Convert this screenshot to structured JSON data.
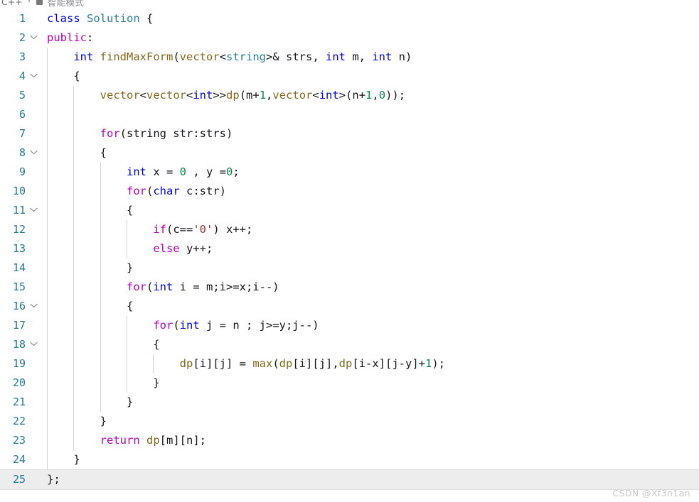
{
  "toolbar": {
    "language": "C++",
    "caret_icon": "chevron-down-icon",
    "stop_icon": "square-icon",
    "mode_label": "智能模式"
  },
  "editor": {
    "language": "cpp",
    "current_line": 25,
    "gutter": {
      "fold_lines": [
        2,
        4,
        8,
        11,
        16,
        18
      ],
      "fold_icon": "chevron-down-icon"
    },
    "colors": {
      "background": "#ffffff",
      "line_number": "#237a91",
      "keyword_type": "#0000ef",
      "keyword_control": "#bb00bb",
      "user_type": "#2b7f8f",
      "identifier": "#7f6a1f",
      "number": "#0b8a52",
      "string": "#9b3030",
      "plain": "#15161a",
      "indent_guide": "#d2d2d2",
      "current_line_highlight": "#ededed"
    },
    "lines": [
      {
        "n": 1,
        "fold": false,
        "guides": [],
        "tokens": [
          {
            "t": "class",
            "c": "k"
          },
          {
            "t": " ",
            "c": "pn"
          },
          {
            "t": "Solution",
            "c": "ty"
          },
          {
            "t": " {",
            "c": "pn"
          }
        ]
      },
      {
        "n": 2,
        "fold": true,
        "guides": [],
        "tokens": [
          {
            "t": "public",
            "c": "kc"
          },
          {
            "t": ":",
            "c": "pn"
          }
        ]
      },
      {
        "n": 3,
        "fold": false,
        "guides": [
          0
        ],
        "tokens": [
          {
            "t": "    ",
            "c": "pn"
          },
          {
            "t": "int",
            "c": "k"
          },
          {
            "t": " ",
            "c": "pn"
          },
          {
            "t": "findMaxForm",
            "c": "fn"
          },
          {
            "t": "(",
            "c": "pn"
          },
          {
            "t": "vector",
            "c": "fn"
          },
          {
            "t": "<",
            "c": "pn"
          },
          {
            "t": "string",
            "c": "ty"
          },
          {
            "t": ">& strs, ",
            "c": "pn"
          },
          {
            "t": "int",
            "c": "k"
          },
          {
            "t": " m, ",
            "c": "pn"
          },
          {
            "t": "int",
            "c": "k"
          },
          {
            "t": " n)",
            "c": "pn"
          }
        ]
      },
      {
        "n": 4,
        "fold": true,
        "guides": [
          0
        ],
        "tokens": [
          {
            "t": "    {",
            "c": "pn"
          }
        ]
      },
      {
        "n": 5,
        "fold": false,
        "guides": [
          0,
          1
        ],
        "tokens": [
          {
            "t": "        ",
            "c": "pn"
          },
          {
            "t": "vector",
            "c": "fn"
          },
          {
            "t": "<",
            "c": "pn"
          },
          {
            "t": "vector",
            "c": "fn"
          },
          {
            "t": "<",
            "c": "pn"
          },
          {
            "t": "int",
            "c": "k"
          },
          {
            "t": ">>",
            "c": "pn"
          },
          {
            "t": "dp",
            "c": "fn"
          },
          {
            "t": "(m+",
            "c": "pn"
          },
          {
            "t": "1",
            "c": "num"
          },
          {
            "t": ",",
            "c": "pn"
          },
          {
            "t": "vector",
            "c": "fn"
          },
          {
            "t": "<",
            "c": "pn"
          },
          {
            "t": "int",
            "c": "k"
          },
          {
            "t": ">(n+",
            "c": "pn"
          },
          {
            "t": "1",
            "c": "num"
          },
          {
            "t": ",",
            "c": "pn"
          },
          {
            "t": "0",
            "c": "num"
          },
          {
            "t": "));",
            "c": "pn"
          }
        ]
      },
      {
        "n": 6,
        "fold": false,
        "guides": [
          0,
          1
        ],
        "tokens": []
      },
      {
        "n": 7,
        "fold": false,
        "guides": [
          0,
          1
        ],
        "tokens": [
          {
            "t": "        ",
            "c": "pn"
          },
          {
            "t": "for",
            "c": "kc"
          },
          {
            "t": "(string str:strs)",
            "c": "pn"
          }
        ]
      },
      {
        "n": 8,
        "fold": true,
        "guides": [
          0,
          1
        ],
        "tokens": [
          {
            "t": "        {",
            "c": "pn"
          }
        ]
      },
      {
        "n": 9,
        "fold": false,
        "guides": [
          0,
          1,
          2
        ],
        "tokens": [
          {
            "t": "            ",
            "c": "pn"
          },
          {
            "t": "int",
            "c": "k"
          },
          {
            "t": " x = ",
            "c": "pn"
          },
          {
            "t": "0",
            "c": "num"
          },
          {
            "t": " , y =",
            "c": "pn"
          },
          {
            "t": "0",
            "c": "num"
          },
          {
            "t": ";",
            "c": "pn"
          }
        ]
      },
      {
        "n": 10,
        "fold": false,
        "guides": [
          0,
          1,
          2
        ],
        "tokens": [
          {
            "t": "            ",
            "c": "pn"
          },
          {
            "t": "for",
            "c": "kc"
          },
          {
            "t": "(",
            "c": "pn"
          },
          {
            "t": "char",
            "c": "k"
          },
          {
            "t": " c:str)",
            "c": "pn"
          }
        ]
      },
      {
        "n": 11,
        "fold": true,
        "guides": [
          0,
          1,
          2
        ],
        "tokens": [
          {
            "t": "            {",
            "c": "pn"
          }
        ]
      },
      {
        "n": 12,
        "fold": false,
        "guides": [
          0,
          1,
          2,
          3
        ],
        "tokens": [
          {
            "t": "                ",
            "c": "pn"
          },
          {
            "t": "if",
            "c": "kc"
          },
          {
            "t": "(c==",
            "c": "pn"
          },
          {
            "t": "'0'",
            "c": "str"
          },
          {
            "t": ") x++;",
            "c": "pn"
          }
        ]
      },
      {
        "n": 13,
        "fold": false,
        "guides": [
          0,
          1,
          2,
          3
        ],
        "tokens": [
          {
            "t": "                ",
            "c": "pn"
          },
          {
            "t": "else",
            "c": "kc"
          },
          {
            "t": " y++;",
            "c": "pn"
          }
        ]
      },
      {
        "n": 14,
        "fold": false,
        "guides": [
          0,
          1,
          2
        ],
        "tokens": [
          {
            "t": "            }",
            "c": "pn"
          }
        ]
      },
      {
        "n": 15,
        "fold": false,
        "guides": [
          0,
          1,
          2
        ],
        "tokens": [
          {
            "t": "            ",
            "c": "pn"
          },
          {
            "t": "for",
            "c": "kc"
          },
          {
            "t": "(",
            "c": "pn"
          },
          {
            "t": "int",
            "c": "k"
          },
          {
            "t": " i = m;i>=x;i--)",
            "c": "pn"
          }
        ]
      },
      {
        "n": 16,
        "fold": true,
        "guides": [
          0,
          1,
          2
        ],
        "tokens": [
          {
            "t": "            {",
            "c": "pn"
          }
        ]
      },
      {
        "n": 17,
        "fold": false,
        "guides": [
          0,
          1,
          2,
          3
        ],
        "tokens": [
          {
            "t": "                ",
            "c": "pn"
          },
          {
            "t": "for",
            "c": "kc"
          },
          {
            "t": "(",
            "c": "pn"
          },
          {
            "t": "int",
            "c": "k"
          },
          {
            "t": " j = n ; j>=y;j--)",
            "c": "pn"
          }
        ]
      },
      {
        "n": 18,
        "fold": true,
        "guides": [
          0,
          1,
          2,
          3
        ],
        "tokens": [
          {
            "t": "                {",
            "c": "pn"
          }
        ]
      },
      {
        "n": 19,
        "fold": false,
        "guides": [
          0,
          1,
          2,
          3,
          4
        ],
        "tokens": [
          {
            "t": "                    ",
            "c": "pn"
          },
          {
            "t": "dp",
            "c": "fn"
          },
          {
            "t": "[i][j] = ",
            "c": "pn"
          },
          {
            "t": "max",
            "c": "fn"
          },
          {
            "t": "(",
            "c": "pn"
          },
          {
            "t": "dp",
            "c": "fn"
          },
          {
            "t": "[i][j],",
            "c": "pn"
          },
          {
            "t": "dp",
            "c": "fn"
          },
          {
            "t": "[i-x][j-y]+",
            "c": "pn"
          },
          {
            "t": "1",
            "c": "num"
          },
          {
            "t": ");",
            "c": "pn"
          }
        ]
      },
      {
        "n": 20,
        "fold": false,
        "guides": [
          0,
          1,
          2,
          3
        ],
        "tokens": [
          {
            "t": "                }",
            "c": "pn"
          }
        ]
      },
      {
        "n": 21,
        "fold": false,
        "guides": [
          0,
          1,
          2
        ],
        "tokens": [
          {
            "t": "            }",
            "c": "pn"
          }
        ]
      },
      {
        "n": 22,
        "fold": false,
        "guides": [
          0,
          1
        ],
        "tokens": [
          {
            "t": "        }",
            "c": "pn"
          }
        ]
      },
      {
        "n": 23,
        "fold": false,
        "guides": [
          0,
          1
        ],
        "tokens": [
          {
            "t": "        ",
            "c": "pn"
          },
          {
            "t": "return",
            "c": "kc"
          },
          {
            "t": " ",
            "c": "pn"
          },
          {
            "t": "dp",
            "c": "fn"
          },
          {
            "t": "[m][n];",
            "c": "pn"
          }
        ]
      },
      {
        "n": 24,
        "fold": false,
        "guides": [
          0
        ],
        "tokens": [
          {
            "t": "    }",
            "c": "pn"
          }
        ]
      },
      {
        "n": 25,
        "fold": false,
        "guides": [],
        "tokens": [
          {
            "t": "};",
            "c": "pn"
          }
        ]
      }
    ]
  },
  "watermark": {
    "text": "CSDN @Xf3n1an"
  }
}
